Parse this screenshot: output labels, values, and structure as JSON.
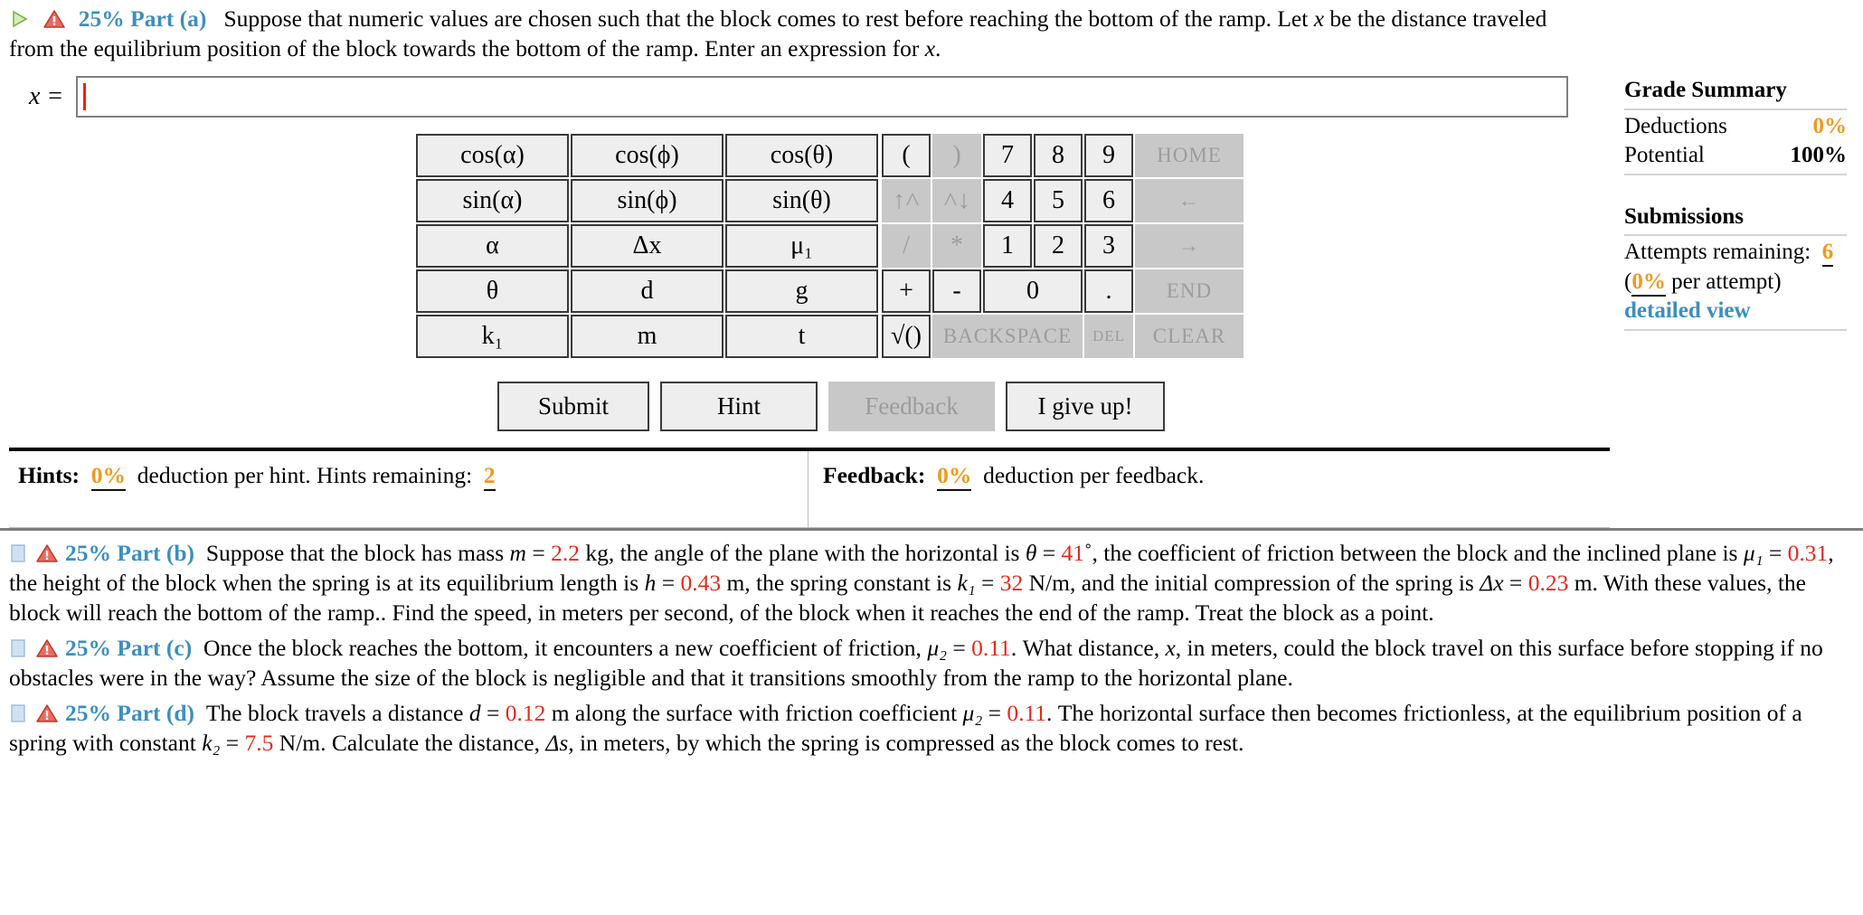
{
  "active_part": {
    "percent": "25%",
    "label": "Part (a)",
    "icon_expand": "triangle-right-icon",
    "icon_warn": "warning-icon",
    "text_1": "Suppose that numeric values are chosen such that the block comes to rest before reaching the bottom of the ramp. Let ",
    "var_x_1": "x",
    "text_2": " be the distance traveled from the equilibrium position of the block towards the bottom of the ramp. Enter an expression for ",
    "var_x_2": "x",
    "text_3": "."
  },
  "answer": {
    "label": "x =",
    "value": "",
    "placeholder": ""
  },
  "keypad": {
    "symbols": [
      [
        "cos(α)",
        "cos(ϕ)",
        "cos(θ)"
      ],
      [
        "sin(α)",
        "sin(ϕ)",
        "sin(θ)"
      ],
      [
        "α",
        "Δx",
        "μ₁"
      ],
      [
        "θ",
        "d",
        "g"
      ],
      [
        "k₁",
        "m",
        "t"
      ]
    ],
    "numeric_rows": [
      [
        {
          "label": "(",
          "dim": false,
          "name": "paren-open-key"
        },
        {
          "label": ")",
          "dim": true,
          "name": "paren-close-key"
        },
        {
          "label": "7",
          "dim": false,
          "name": "seven-key"
        },
        {
          "label": "8",
          "dim": false,
          "name": "eight-key"
        },
        {
          "label": "9",
          "dim": false,
          "name": "nine-key"
        },
        {
          "label": "HOME",
          "dim": true,
          "name": "home-key"
        }
      ],
      [
        {
          "label": "↑˄",
          "dim": true,
          "name": "superscript-key"
        },
        {
          "label": "˄↓",
          "dim": true,
          "name": "subscript-key"
        },
        {
          "label": "4",
          "dim": false,
          "name": "four-key"
        },
        {
          "label": "5",
          "dim": false,
          "name": "five-key"
        },
        {
          "label": "6",
          "dim": false,
          "name": "six-key"
        },
        {
          "label": "←",
          "dim": true,
          "name": "arrow-left-key"
        }
      ],
      [
        {
          "label": "/",
          "dim": true,
          "name": "divide-key"
        },
        {
          "label": "*",
          "dim": true,
          "name": "multiply-key"
        },
        {
          "label": "1",
          "dim": false,
          "name": "one-key"
        },
        {
          "label": "2",
          "dim": false,
          "name": "two-key"
        },
        {
          "label": "3",
          "dim": false,
          "name": "three-key"
        },
        {
          "label": "→",
          "dim": true,
          "name": "arrow-right-key"
        }
      ],
      [
        {
          "label": "+",
          "dim": false,
          "name": "plus-key"
        },
        {
          "label": "-",
          "dim": false,
          "name": "minus-key"
        },
        {
          "label": "0",
          "dim": false,
          "name": "zero-key"
        },
        {
          "label": ".",
          "dim": false,
          "name": "decimal-key"
        },
        {
          "label": "END",
          "dim": true,
          "name": "end-key"
        }
      ],
      [
        {
          "label": "√()",
          "dim": false,
          "name": "sqrt-key"
        },
        {
          "label": "BACKSPACE",
          "dim": true,
          "name": "backspace-key"
        },
        {
          "label": "DEL",
          "dim": true,
          "name": "delete-key"
        },
        {
          "label": "CLEAR",
          "dim": true,
          "name": "clear-key"
        }
      ]
    ]
  },
  "buttons": {
    "submit": "Submit",
    "hint": "Hint",
    "feedback": "Feedback",
    "giveup": "I give up!"
  },
  "hints_bar": {
    "hints_label": "Hints:",
    "hints_deduction": "0%",
    "hints_text": "deduction per hint. Hints remaining:",
    "hints_remaining": "2",
    "feedback_label": "Feedback:",
    "feedback_deduction": "0%",
    "feedback_text": "deduction per feedback."
  },
  "grade_summary": {
    "title": "Grade Summary",
    "deductions_label": "Deductions",
    "deductions_value": "0%",
    "potential_label": "Potential",
    "potential_value": "100%",
    "submissions_title": "Submissions",
    "attempts_label": "Attempts remaining:",
    "attempts_value": "6",
    "per_attempt_open": "(",
    "per_attempt_value": "0%",
    "per_attempt_text": " per attempt)",
    "detailed_view": "detailed view"
  },
  "parts": [
    {
      "percent": "25%",
      "label": "Part (b)",
      "segments": [
        {
          "t": "Suppose that the block has mass ",
          "s": "plain"
        },
        {
          "t": "m",
          "s": "italic"
        },
        {
          "t": " = ",
          "s": "plain"
        },
        {
          "t": "2.2",
          "s": "red"
        },
        {
          "t": " kg, the angle of the plane with the horizontal is ",
          "s": "plain"
        },
        {
          "t": "θ",
          "s": "italic"
        },
        {
          "t": " = ",
          "s": "plain"
        },
        {
          "t": "41",
          "s": "red"
        },
        {
          "t": "˚, the coefficient of friction between the block and the inclined plane is ",
          "s": "plain"
        },
        {
          "t": "μ₁",
          "s": "italic"
        },
        {
          "t": " = ",
          "s": "plain"
        },
        {
          "t": "0.31",
          "s": "red"
        },
        {
          "t": ", the height of the block when the spring is at its equilibrium length is ",
          "s": "plain"
        },
        {
          "t": "h",
          "s": "italic"
        },
        {
          "t": " = ",
          "s": "plain"
        },
        {
          "t": "0.43",
          "s": "red"
        },
        {
          "t": " m, the spring constant is ",
          "s": "plain"
        },
        {
          "t": "k₁",
          "s": "italic"
        },
        {
          "t": " = ",
          "s": "plain"
        },
        {
          "t": "32",
          "s": "red"
        },
        {
          "t": " N/m, and the initial compression of the spring is ",
          "s": "plain"
        },
        {
          "t": "Δx",
          "s": "italic"
        },
        {
          "t": " = ",
          "s": "plain"
        },
        {
          "t": "0.23",
          "s": "red"
        },
        {
          "t": " m. With these values, the block will reach the bottom of the ramp.. Find the speed, in meters per second, of the block when it reaches the end of the ramp. Treat the block as a point.",
          "s": "plain"
        }
      ]
    },
    {
      "percent": "25%",
      "label": "Part (c)",
      "segments": [
        {
          "t": "Once the block reaches the bottom, it encounters a new coefficient of friction, ",
          "s": "plain"
        },
        {
          "t": "μ₂",
          "s": "italic"
        },
        {
          "t": " = ",
          "s": "plain"
        },
        {
          "t": "0.11",
          "s": "red"
        },
        {
          "t": ". What distance, ",
          "s": "plain"
        },
        {
          "t": "x",
          "s": "italic"
        },
        {
          "t": ", in meters, could the block travel on this surface before stopping if no obstacles were in the way? Assume the size of the block is negligible and that it transitions smoothly from the ramp to the horizontal plane.",
          "s": "plain"
        }
      ]
    },
    {
      "percent": "25%",
      "label": "Part (d)",
      "segments": [
        {
          "t": "The block travels a distance ",
          "s": "plain"
        },
        {
          "t": "d",
          "s": "italic"
        },
        {
          "t": " = ",
          "s": "plain"
        },
        {
          "t": "0.12",
          "s": "red"
        },
        {
          "t": " m along the surface with friction coefficient ",
          "s": "plain"
        },
        {
          "t": "μ₂",
          "s": "italic"
        },
        {
          "t": " = ",
          "s": "plain"
        },
        {
          "t": "0.11",
          "s": "red"
        },
        {
          "t": ". The horizontal surface then becomes frictionless, at the equilibrium position of a spring with constant ",
          "s": "plain"
        },
        {
          "t": "k₂",
          "s": "italic"
        },
        {
          "t": " = ",
          "s": "plain"
        },
        {
          "t": "7.5",
          "s": "red"
        },
        {
          "t": " N/m. Calculate the distance, ",
          "s": "plain"
        },
        {
          "t": "Δs",
          "s": "italic"
        },
        {
          "t": ", in meters, by which the spring is compressed as the block comes to rest.",
          "s": "plain"
        }
      ]
    }
  ],
  "colors": {
    "accent_blue": "#3c8fbf",
    "value_red": "#e8281e",
    "orange": "#f0991e",
    "key_face": "#eeeeee",
    "key_disabled": "#c8c8c8"
  }
}
